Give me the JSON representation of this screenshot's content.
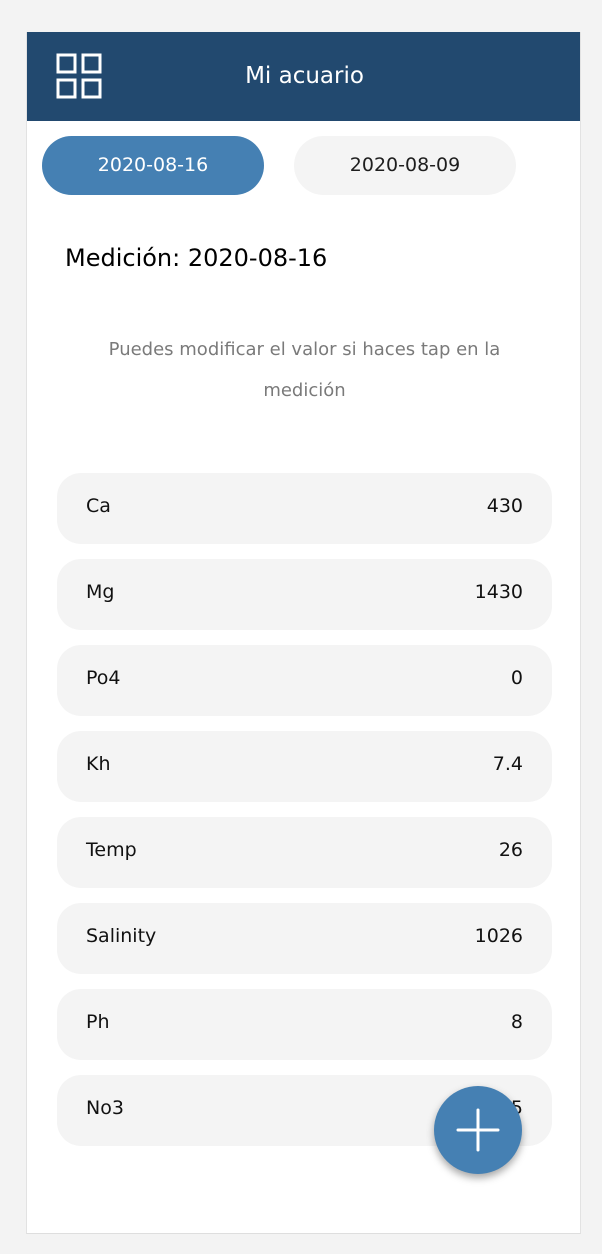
{
  "header": {
    "title": "Mi acuario",
    "menu_icon": "grid-icon",
    "background_color": "#22496f"
  },
  "date_tabs": [
    {
      "label": "2020-08-16",
      "selected": true
    },
    {
      "label": "2020-08-09",
      "selected": false
    }
  ],
  "measurement": {
    "title": "Medición: 2020-08-16",
    "hint": "Puedes modificar el valor si haces tap en la medición"
  },
  "parameters": [
    {
      "label": "Ca",
      "value": "430"
    },
    {
      "label": "Mg",
      "value": "1430"
    },
    {
      "label": "Po4",
      "value": "0"
    },
    {
      "label": "Kh",
      "value": "7.4"
    },
    {
      "label": "Temp",
      "value": "26"
    },
    {
      "label": "Salinity",
      "value": "1026"
    },
    {
      "label": "Ph",
      "value": "8"
    },
    {
      "label": "No3",
      "value": "5"
    }
  ],
  "fab": {
    "icon": "plus-icon",
    "color": "#4580b3"
  },
  "colors": {
    "accent": "#4580b3",
    "row_background": "#f4f4f4"
  }
}
